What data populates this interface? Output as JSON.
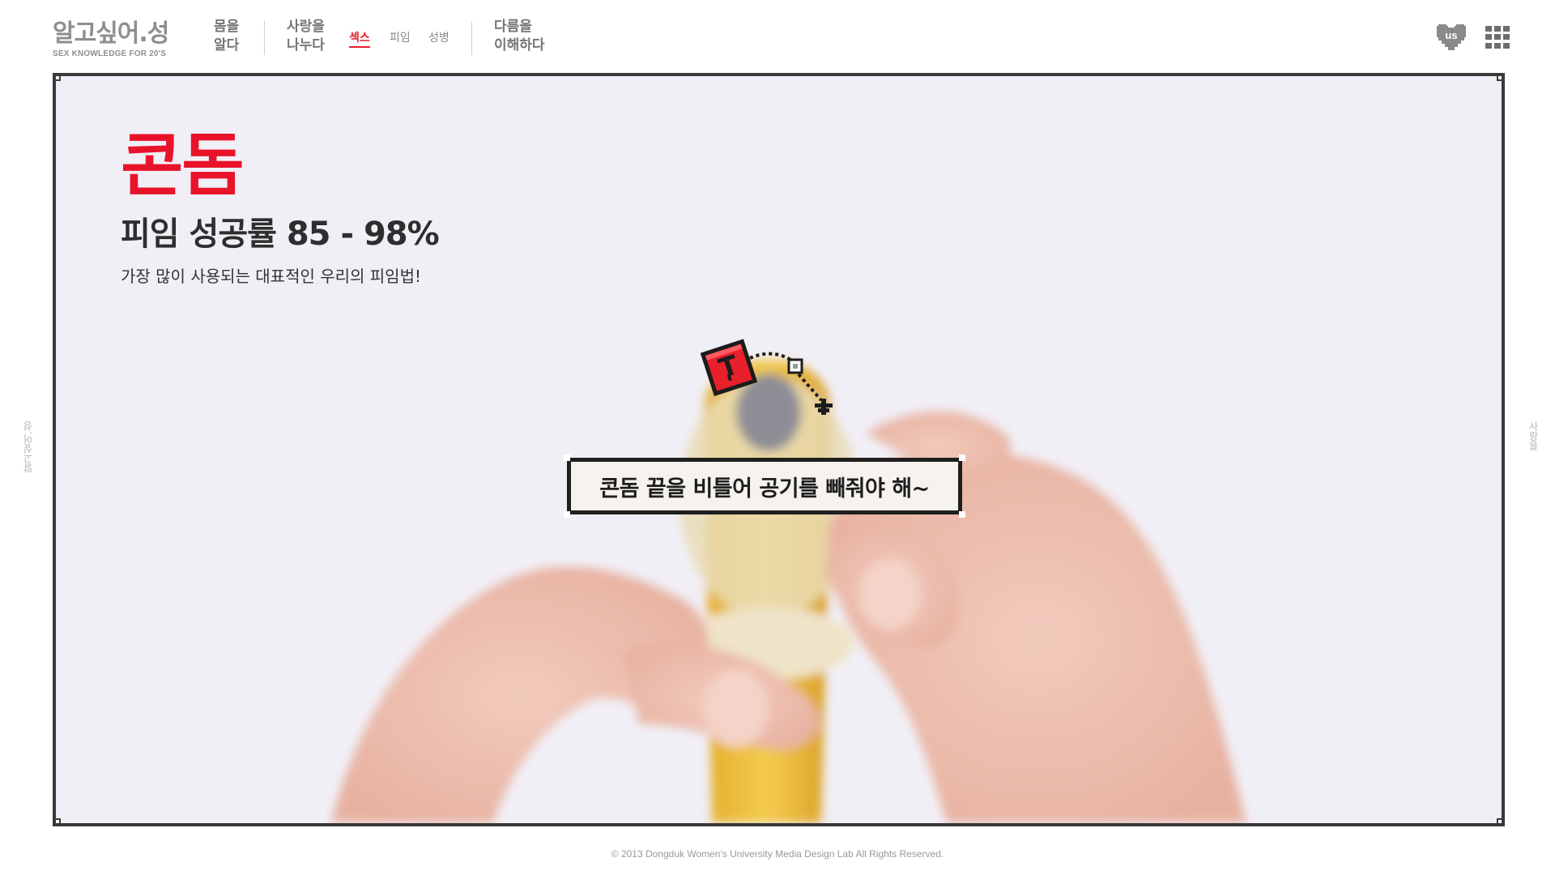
{
  "logo": {
    "title": "알고싶어.성",
    "subtitle": "SEX KNOWLEDGE FOR 20'S"
  },
  "nav": {
    "item1": {
      "line1": "몸을",
      "line2": "알다"
    },
    "item2": {
      "line1": "사랑을",
      "line2": "나누다"
    },
    "sub_items": [
      "섹스",
      "피임",
      "성병"
    ],
    "active_sub": "섹스",
    "item3": {
      "line1": "다름을",
      "line2": "이해하다"
    }
  },
  "content": {
    "title": "콘돔",
    "success_rate": "피임 성공률 85 - 98%",
    "description": "가장 많이 사용되는 대표적인 우리의 피임법!",
    "speech": "콘돔 끝을 비틀어 공기를 빼줘야 해~"
  },
  "side": {
    "left": "알고싶어.성",
    "right": "사랑을"
  },
  "footer": "© 2013 Dongduk Women's University Media Design Lab All Rights Reserved.",
  "icons": [
    "us-heart-icon",
    "grid-menu-icon",
    "pin-sticker-icon",
    "pixel-arrow-icon"
  ],
  "colors": {
    "accent": "#e8132a",
    "frame": "#3a3a3a",
    "nav_text": "#757575",
    "background": "#f0eef5"
  }
}
